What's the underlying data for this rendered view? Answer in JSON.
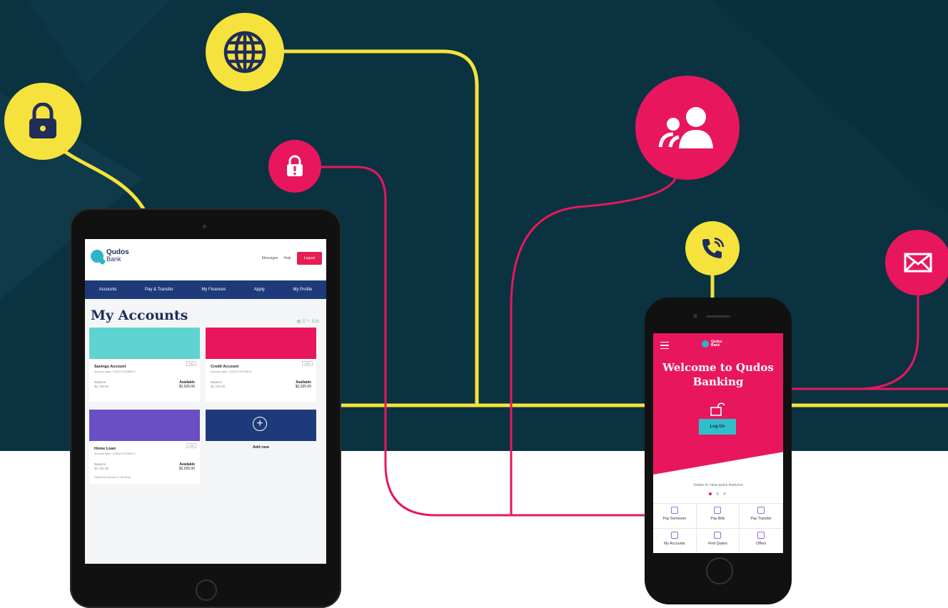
{
  "colors": {
    "background_dark": "#0b3240",
    "yellow": "#f5e23c",
    "pink": "#e8175d",
    "navy": "#1f3a7a",
    "teal": "#2fb3c6"
  },
  "nodes": [
    {
      "icon": "lock-icon",
      "color": "yellow"
    },
    {
      "icon": "globe-icon",
      "color": "yellow"
    },
    {
      "icon": "alert-lock-icon",
      "color": "pink"
    },
    {
      "icon": "community-icon",
      "color": "pink"
    },
    {
      "icon": "phone-call-icon",
      "color": "yellow"
    },
    {
      "icon": "mail-icon",
      "color": "pink"
    }
  ],
  "tablet": {
    "logo": {
      "line1": "Qudos",
      "line2": "Bank"
    },
    "header": {
      "messages": "Messages",
      "help": "Help",
      "logout": "Logout"
    },
    "nav": [
      "Accounts",
      "Pay & Transfer",
      "My Finances",
      "Apply",
      "My Profile"
    ],
    "page_title": "My Accounts",
    "tools_label": "Edit",
    "accounts": [
      {
        "name": "Savings Account",
        "number": "Account type: 123012 34789012",
        "balance_label": "Balance",
        "balance": "$1,725.00",
        "available_label": "Available",
        "available": "$2,025.00",
        "tag": "SAV"
      },
      {
        "name": "Credit Account",
        "number": "Account type: 123012 34789012",
        "balance_label": "Balance",
        "balance": "$1,725.00",
        "available_label": "Available",
        "available": "$2,025.00",
        "tag": "CRD"
      },
      {
        "name": "Home Loan",
        "number": "Account type: 123012 34789012",
        "balance_label": "Balance",
        "balance": "$1,725.00",
        "available_label": "Available",
        "available": "$2,025.00",
        "tag": "LON",
        "payment": "Payment overdue 5 Jul 2018"
      }
    ],
    "add_new": "Add new"
  },
  "phone": {
    "logo": {
      "line1": "Qudos",
      "line2": "Bank"
    },
    "welcome": "Welcome to Qudos Banking",
    "log_on": "Log On",
    "swipe_hint": "Swipe to view quick features",
    "features": [
      "Pay Someone",
      "Pay Bills",
      "Pay Transfer",
      "My Accounts",
      "Find Qudos",
      "Offers"
    ]
  }
}
